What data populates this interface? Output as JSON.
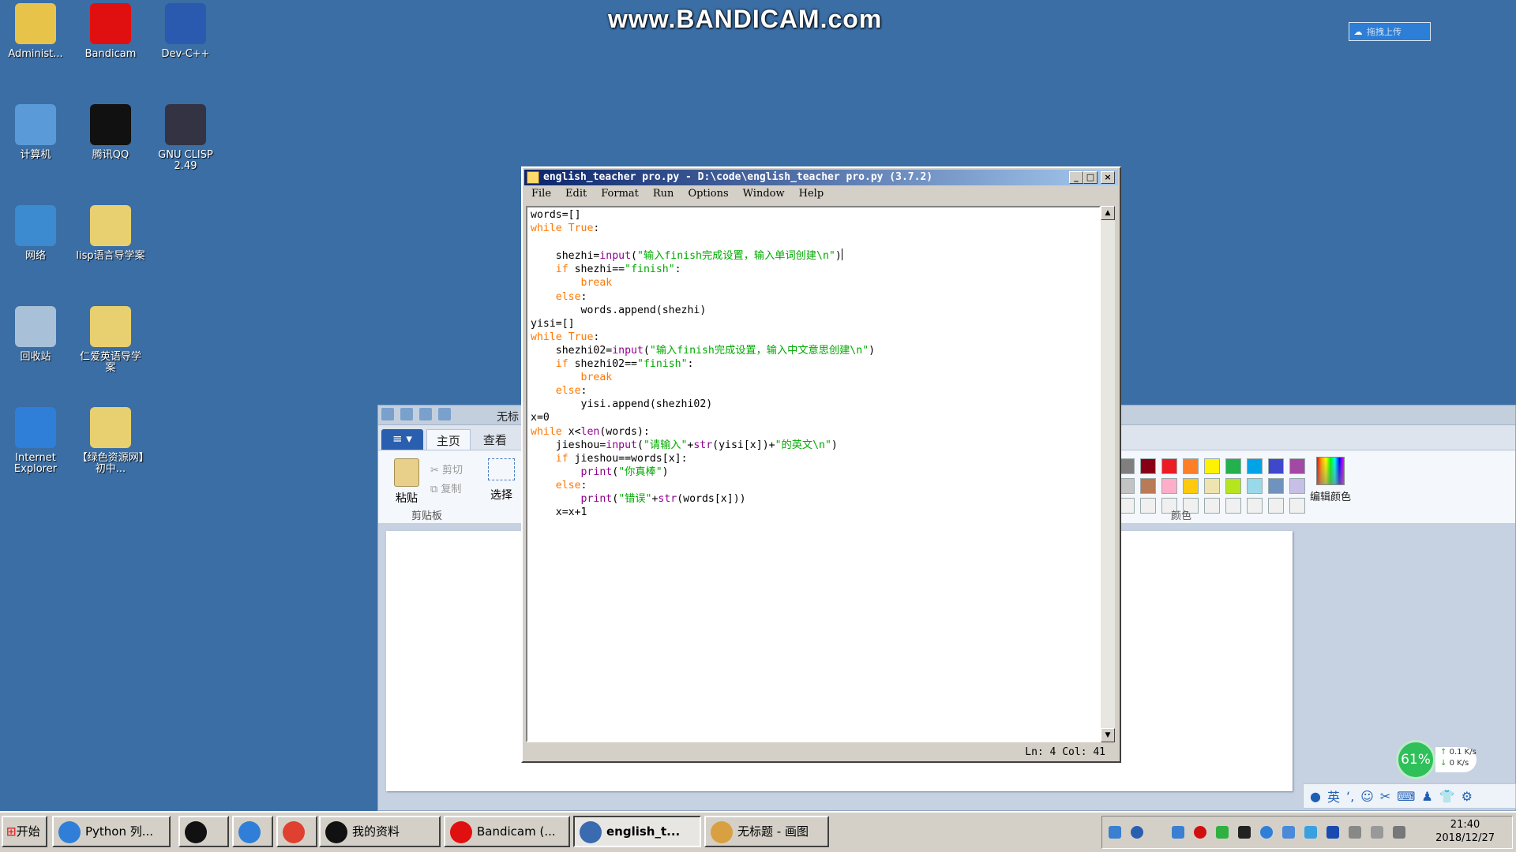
{
  "watermark": "www.BANDICAM.com",
  "upload_widget": {
    "label": "拖拽上传"
  },
  "desktop_icons": [
    {
      "label": "Administ...",
      "color": "#e8c34a"
    },
    {
      "label": "Bandicam",
      "color": "#e01010"
    },
    {
      "label": "Dev-C++",
      "color": "#2a5ab0"
    },
    {
      "label": "计算机",
      "color": "#5a9ad8"
    },
    {
      "label": "腾讯QQ",
      "color": "#111111"
    },
    {
      "label": "GNU CLISP 2.49",
      "color": "#334"
    },
    {
      "label": "网络",
      "color": "#3c8ad0"
    },
    {
      "label": "lisp语言导学案",
      "color": "#e8d070"
    },
    {
      "label": "回收站",
      "color": "#a8c0d8"
    },
    {
      "label": "仁爱英语导学案",
      "color": "#e8d070"
    },
    {
      "label": "Internet Explorer",
      "color": "#2f7fd8"
    },
    {
      "label": "【绿色资源网】初中...",
      "color": "#e8d070"
    }
  ],
  "paint": {
    "title": "无标",
    "tabs": {
      "file": "≡ ▾",
      "home": "主页",
      "view": "查看"
    },
    "paste": "粘贴",
    "cut": "剪切",
    "copy": "复制",
    "select": "选择",
    "clipboard_group": "剪贴板",
    "colors_group": "颜色",
    "edit_colors": "编辑颜色",
    "palette": [
      "#7f7f7f",
      "#880015",
      "#ed1c24",
      "#ff7f27",
      "#fff200",
      "#22b14c",
      "#00a2e8",
      "#3f48cc",
      "#a349a4",
      "#c3c3c3",
      "#b97a57",
      "#ffaec9",
      "#ffc90e",
      "#efe4b0",
      "#b5e61d",
      "#99d9ea",
      "#7092be",
      "#c8bfe7",
      "#f0f0f0",
      "#f0f0f0",
      "#f0f0f0",
      "#f0f0f0",
      "#f0f0f0",
      "#f0f0f0",
      "#f0f0f0",
      "#f0f0f0",
      "#f0f0f0"
    ]
  },
  "idle": {
    "title": "english_teacher pro.py - D:\\code\\english_teacher pro.py (3.7.2)",
    "menu": [
      "File",
      "Edit",
      "Format",
      "Run",
      "Options",
      "Window",
      "Help"
    ],
    "status": "Ln: 4  Col: 41",
    "code_lines": [
      "words=[]",
      "while True:",
      "",
      "    shezhi=input(\"输入finish完成设置，输入单词创建\\n\")",
      "    if shezhi==\"finish\":",
      "        break",
      "    else:",
      "        words.append(shezhi)",
      "yisi=[]",
      "while True:",
      "    shezhi02=input(\"输入finish完成设置，输入中文意思创建\\n\")",
      "    if shezhi02==\"finish\":",
      "        break",
      "    else:",
      "        yisi.append(shezhi02)",
      "x=0",
      "while x<len(words):",
      "    jieshou=input(\"请输入\"+str(yisi[x])+\"的英文\\n\")",
      "    if jieshou==words[x]:",
      "        print(\"你真棒\")",
      "    else:",
      "        print(\"错误\"+str(words[x]))",
      "    x=x+1"
    ]
  },
  "taskbar": {
    "start": "开始",
    "items": [
      {
        "label": "Python 列...",
        "color": "#2f7fd8"
      },
      {
        "label": "",
        "color": "#111111"
      },
      {
        "label": "",
        "color": "#2f7fd8"
      },
      {
        "label": "",
        "color": "#e04030"
      },
      {
        "label": "我的资料",
        "color": "#111111"
      },
      {
        "label": "Bandicam (...",
        "color": "#e01010"
      },
      {
        "label": "english_t...",
        "color": "#3a6ab0"
      },
      {
        "label": "无标题 - 画图",
        "color": "#d8a040"
      }
    ],
    "clock_time": "21:40",
    "clock_date": "2018/12/27"
  },
  "net_widget": {
    "percent": "61%",
    "up": "0.1 K/s",
    "down": "0 K/s"
  },
  "ime_bar": {
    "lang": "英"
  }
}
